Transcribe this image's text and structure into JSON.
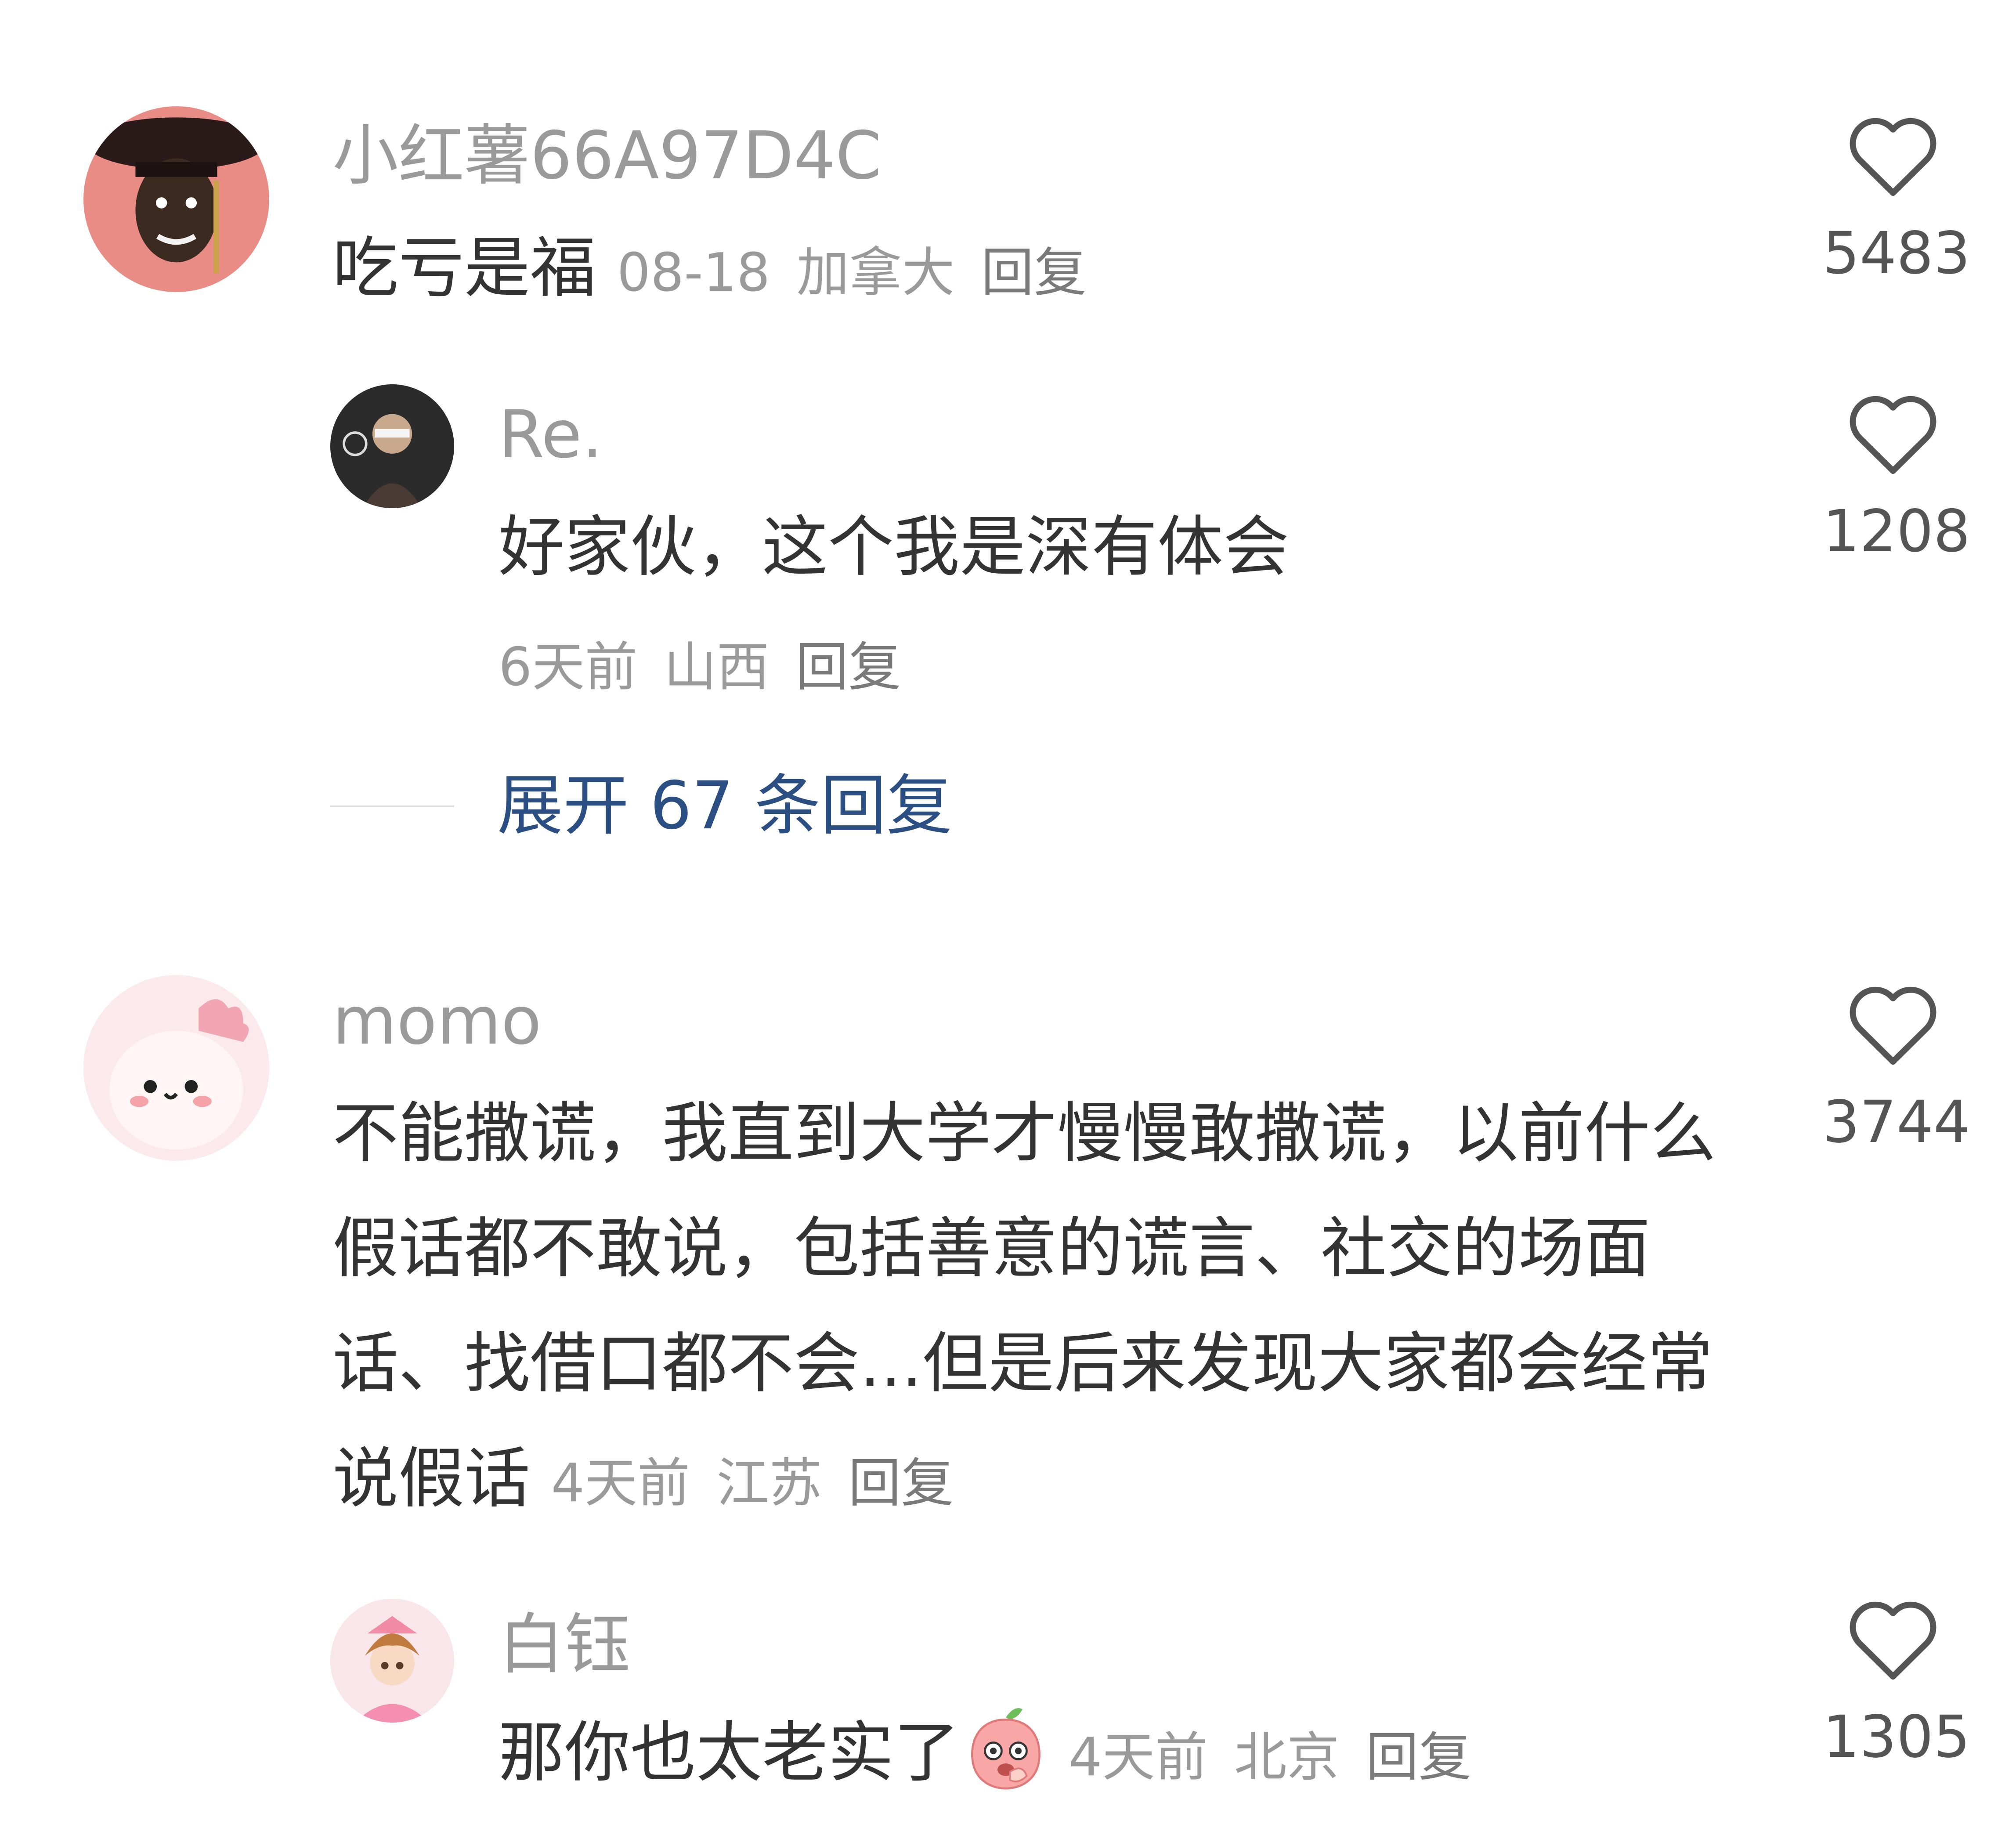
{
  "comments": [
    {
      "author": "小红薯66A97D4C",
      "text": "吃亏是福",
      "meta": {
        "time": "08-18",
        "location": "加拿大",
        "reply": "回复"
      },
      "likes": "5483",
      "avatar_icon": "user-avatar"
    },
    {
      "author": "Re.",
      "text": "好家伙，这个我是深有体会",
      "meta": {
        "time": "6天前",
        "location": "山西",
        "reply": "回复"
      },
      "likes": "1208",
      "avatar_icon": "user-avatar"
    },
    {
      "author": "momo",
      "text": "不能撒谎，我直到大学才慢慢敢撒谎，以前什么假话都不敢说，包括善意的谎言、社交的场面话、找借口都不会...但是后来发现大家都会经常说假话",
      "meta": {
        "time": "4天前",
        "location": "江苏",
        "reply": "回复"
      },
      "likes": "3744",
      "avatar_icon": "cartoon-avatar"
    },
    {
      "author": "白钰",
      "text": "那你也太老实了",
      "meta": {
        "time": "4天前",
        "location": "北京",
        "reply": "回复"
      },
      "likes": "1305",
      "avatar_icon": "anime-avatar",
      "emoji": "peach-emoji"
    }
  ],
  "expand_replies": "展开 67 条回复",
  "colors": {
    "text": "#333333",
    "meta": "#9a9a9a",
    "link": "#2b4f83",
    "background": "#ffffff"
  }
}
